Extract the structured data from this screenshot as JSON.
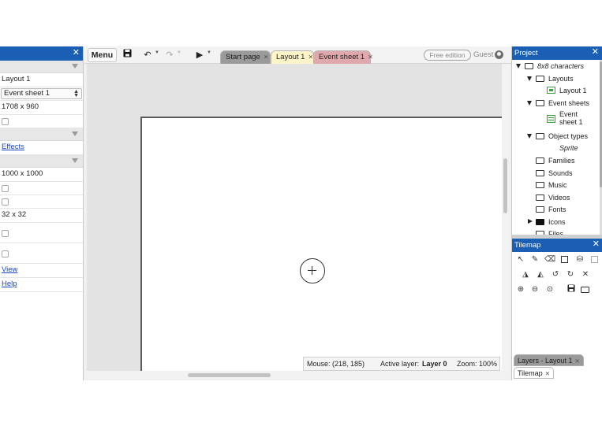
{
  "properties_panel": {
    "layout_name": "Layout 1",
    "event_sheet": "Event sheet 1",
    "layout_size": "1708 x 960",
    "effects_link": "Effects",
    "viewport_size": "1000 x 1000",
    "grid_size": "32 x 32",
    "view_link": "View",
    "help_link": "Help",
    "close_glyph": "✕"
  },
  "toolbar": {
    "menu_label": "Menu",
    "tabs": [
      {
        "label": "Start page",
        "close": "✕"
      },
      {
        "label": "Layout 1",
        "close": "✕"
      },
      {
        "label": "Event sheet 1",
        "close": "✕"
      }
    ],
    "free_edition": "Free edition",
    "guest": "Guest"
  },
  "status": {
    "mouse_label": "Mouse: (218, 185)",
    "active_layer_label": "Active layer:",
    "active_layer_value": "Layer 0",
    "zoom_label": "Zoom: 100%"
  },
  "project_panel": {
    "title": "Project",
    "root": "8x8 characters",
    "layouts": "Layouts",
    "layout_item": "Layout 1",
    "event_sheets": "Event sheets",
    "event_item_line1": "Event",
    "event_item_line2": "sheet 1",
    "object_types": "Object types",
    "sprite": "Sprite",
    "families": "Families",
    "sounds": "Sounds",
    "music": "Music",
    "videos": "Videos",
    "fonts": "Fonts",
    "icons": "Icons",
    "files": "Files"
  },
  "tilemap_panel": {
    "title": "Tilemap",
    "tabs": [
      {
        "label": "Layers - Layout 1",
        "close": "✕"
      },
      {
        "label": "Tilemap",
        "close": "✕"
      }
    ]
  },
  "colors": {
    "title_bar": "#1a5fb4",
    "layout_tab": "#fff5c8",
    "event_tab": "#e0a8ac",
    "start_tab": "#9a9a9a"
  }
}
